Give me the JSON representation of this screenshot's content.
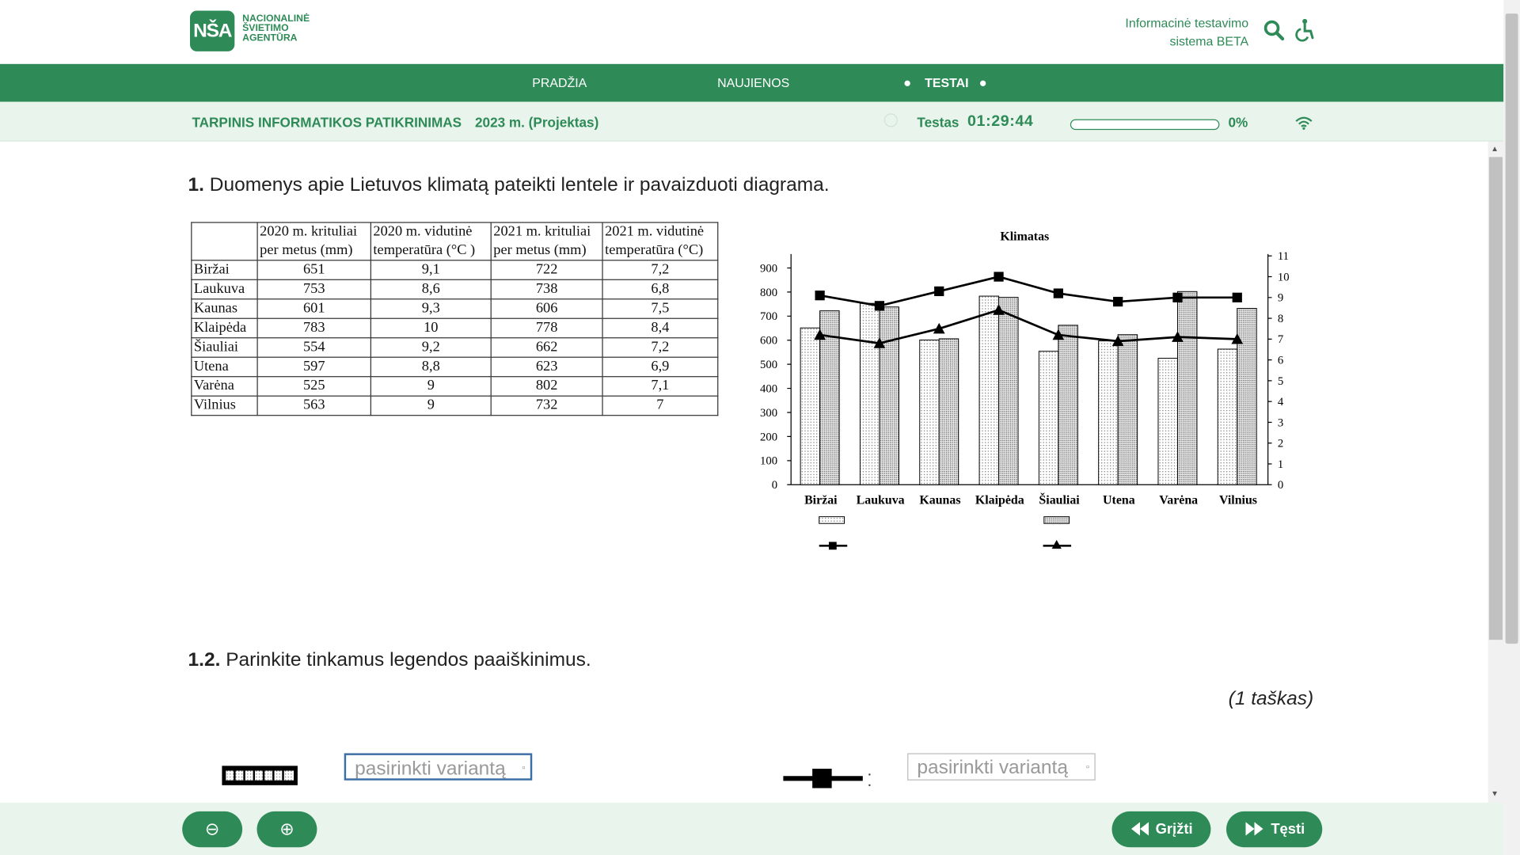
{
  "header": {
    "logo_mark": "NŠA",
    "logo_lines": [
      "NACIONALINĖ",
      "ŠVIETIMO",
      "AGENTŪRA"
    ],
    "info_line1": "Informacinė testavimo",
    "info_line2": "sistema BETA"
  },
  "nav": {
    "items": [
      "PRADŽIA",
      "NAUJIENOS",
      "TESTAI"
    ]
  },
  "subbar": {
    "title": "TARPINIS INFORMATIKOS PATIKRINIMAS",
    "version": "2023 m. (Projektas)",
    "test_label": "Testas",
    "timer": "01:29:44",
    "progress_percent": 0,
    "progress_label": "0%"
  },
  "question": {
    "number": "1.",
    "text": "Duomenys apie Lietuvos klimatą pateikti lentele ir pavaizduoti diagrama.",
    "sub_number": "1.2.",
    "sub_text": "Parinkite tinkamus legendos paaiškinimus.",
    "points": "(1 taškas)"
  },
  "table": {
    "headers": [
      "",
      "2020 m. krituliai per metus (mm)",
      "2020 m. vidutinė temperatūra (°C )",
      "2021 m. krituliai per metus (mm)",
      "2021 m. vidutinė temperatūra (°C)"
    ],
    "rows": [
      [
        "Biržai",
        "651",
        "9,1",
        "722",
        "7,2"
      ],
      [
        "Laukuva",
        "753",
        "8,6",
        "738",
        "6,8"
      ],
      [
        "Kaunas",
        "601",
        "9,3",
        "606",
        "7,5"
      ],
      [
        "Klaipėda",
        "783",
        "10",
        "778",
        "8,4"
      ],
      [
        "Šiauliai",
        "554",
        "9,2",
        "662",
        "7,2"
      ],
      [
        "Utena",
        "597",
        "8,8",
        "623",
        "6,9"
      ],
      [
        "Varėna",
        "525",
        "9",
        "802",
        "7,1"
      ],
      [
        "Vilnius",
        "563",
        "9",
        "732",
        "7"
      ]
    ]
  },
  "chart_data": {
    "type": "bar",
    "title": "Klimatas",
    "categories": [
      "Biržai",
      "Laukuva",
      "Kaunas",
      "Klaipėda",
      "Šiauliai",
      "Utena",
      "Varėna",
      "Vilnius"
    ],
    "series": [
      {
        "kind": "bar",
        "axis": "left",
        "values": [
          651,
          753,
          601,
          783,
          554,
          597,
          525,
          563
        ]
      },
      {
        "kind": "bar",
        "axis": "left",
        "values": [
          722,
          738,
          606,
          778,
          662,
          623,
          802,
          732
        ]
      },
      {
        "kind": "line",
        "axis": "right",
        "marker": "square",
        "values": [
          9.1,
          8.6,
          9.3,
          10,
          9.2,
          8.8,
          9,
          9
        ]
      },
      {
        "kind": "line",
        "axis": "right",
        "marker": "triangle",
        "values": [
          7.2,
          6.8,
          7.5,
          8.4,
          7.2,
          6.9,
          7.1,
          7
        ]
      }
    ],
    "left_ticks": [
      "0",
      "100",
      "200",
      "300",
      "400",
      "500",
      "600",
      "700",
      "800",
      "900"
    ],
    "right_ticks": [
      "0",
      "1",
      "2",
      "3",
      "4",
      "5",
      "6",
      "7",
      "8",
      "9",
      "10",
      "11"
    ],
    "ylim_left": [
      0,
      950
    ],
    "ylim_right": [
      0,
      11
    ],
    "grid": false,
    "legend": "bottom"
  },
  "answers": {
    "select1_placeholder": "pasirinkti variantą",
    "select2_placeholder": "pasirinkti variantą"
  },
  "footer": {
    "zoom_out": "⊖",
    "zoom_in": "⊕",
    "back_label": "Grįžti",
    "next_label": "Tęsti"
  },
  "colors": {
    "brand": "#2e8b57",
    "subbar_bg": "#e9f5ec"
  }
}
